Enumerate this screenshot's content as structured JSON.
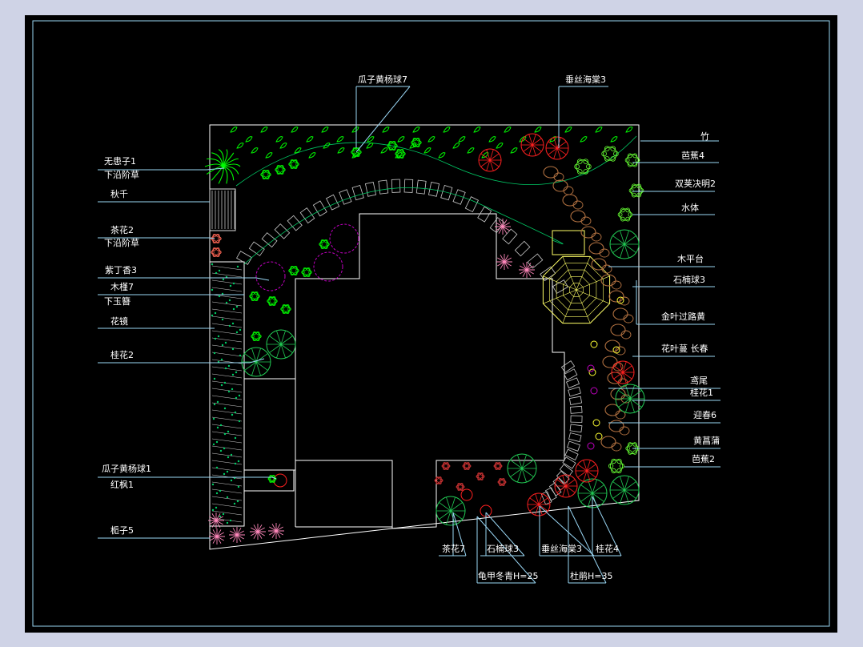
{
  "drawing": {
    "labels_left": [
      {
        "id": "wuhuanzi",
        "text": "无患子1"
      },
      {
        "id": "xiayanjiecao1",
        "text": "下沿阶草"
      },
      {
        "id": "qiuqian",
        "text": "秋千"
      },
      {
        "id": "chahua2",
        "text": "茶花2"
      },
      {
        "id": "xiayanjiecao2",
        "text": "下沿阶草"
      },
      {
        "id": "zidingxiang",
        "text": "紫丁香3"
      },
      {
        "id": "mujin",
        "text": "木槿7"
      },
      {
        "id": "xiayuzan",
        "text": "下玉簪"
      },
      {
        "id": "huajing",
        "text": "花镜"
      },
      {
        "id": "guihua2",
        "text": "桂花2"
      },
      {
        "id": "guaziyang1",
        "text": "瓜子黄杨球1"
      },
      {
        "id": "hongfeng",
        "text": "红枫1"
      },
      {
        "id": "zhizi",
        "text": "栀子5"
      }
    ],
    "labels_top": [
      {
        "id": "guaziyang7",
        "text": "瓜子黄杨球7"
      },
      {
        "id": "chuisi_top",
        "text": "垂丝海棠3"
      }
    ],
    "labels_right": [
      {
        "id": "zhu",
        "text": "竹"
      },
      {
        "id": "bajiao4",
        "text": "芭蕉4"
      },
      {
        "id": "shuangjia",
        "text": "双荚决明2"
      },
      {
        "id": "shuiti",
        "text": "水体"
      },
      {
        "id": "mupingtai",
        "text": "木平台"
      },
      {
        "id": "shinan_r",
        "text": "石楠球3"
      },
      {
        "id": "jinye",
        "text": "金叶过路黄"
      },
      {
        "id": "huaye",
        "text": "花叶蔓 长春"
      },
      {
        "id": "yuanwei",
        "text": "鸢尾"
      },
      {
        "id": "guihua1",
        "text": "桂花1"
      },
      {
        "id": "yingchun",
        "text": "迎春6"
      },
      {
        "id": "huangchangpu",
        "text": "黄菖蒲"
      },
      {
        "id": "bajiao2",
        "text": "芭蕉2"
      }
    ],
    "labels_bottom": [
      {
        "id": "chahua7",
        "text": "茶花7"
      },
      {
        "id": "shinan_b",
        "text": "石楠球3"
      },
      {
        "id": "chuisi_b",
        "text": "垂丝海棠3"
      },
      {
        "id": "guihua4",
        "text": "桂花4"
      },
      {
        "id": "guijia",
        "text": "龟甲冬青H=25"
      },
      {
        "id": "dujuan",
        "text": "杜鹃H=35"
      }
    ],
    "colors": {
      "background": "#000000",
      "frame": "#ffffff",
      "leader": "#9ad7f5",
      "shrub": "#00ff00",
      "red_tree": "#ff2020",
      "magenta": "#c000c0",
      "pink": "#ff88bb",
      "rock": "#b07040",
      "deck": "#ffff66"
    }
  }
}
